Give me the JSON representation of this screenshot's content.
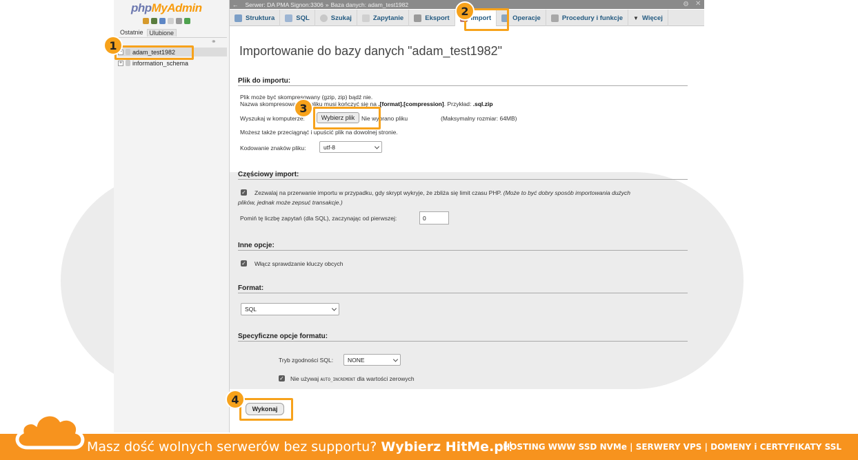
{
  "app": {
    "logo_php": "php",
    "logo_myadmin": "MyAdmin"
  },
  "nav": {
    "tabs": [
      "Ostatnie",
      "Ulubione"
    ],
    "databases": [
      "adam_test1982",
      "information_schema"
    ]
  },
  "breadcrumb": {
    "server": "Serwer: DA PMA Signon:3306",
    "separator": "»",
    "database": "Baza danych: adam_test1982"
  },
  "tabs": [
    {
      "label": "Struktura",
      "icon": "structure-icon"
    },
    {
      "label": "SQL",
      "icon": "sql-icon"
    },
    {
      "label": "Szukaj",
      "icon": "search-icon"
    },
    {
      "label": "Zapytanie",
      "icon": "query-icon"
    },
    {
      "label": "Eksport",
      "icon": "export-icon"
    },
    {
      "label": "Import",
      "icon": "import-icon",
      "active": true
    },
    {
      "label": "Operacje",
      "icon": "wrench-icon"
    },
    {
      "label": "Procedury i funkcje",
      "icon": "routines-icon"
    },
    {
      "label": "Więcej",
      "icon": "chevron-down-icon"
    }
  ],
  "page": {
    "title": "Importowanie do bazy danych \"adam_test1982\""
  },
  "file_section": {
    "legend": "Plik do importu:",
    "line1": "Plik może być skompresowany (gzip, zip) bądź nie.",
    "line2_prefix": "Nazwa skompresowanego pliku musi kończyć się na ",
    "line2_format": ".[format].[compression]",
    "line2_mid": ". Przykład: ",
    "line2_example": ".sql.zip",
    "browse_label": "Wyszukaj w komputerze:",
    "choose_button": "Wybierz plik",
    "no_file": "Nie wybrano pliku",
    "max_size": "(Maksymalny rozmiar: 64MB)",
    "drag_hint": "Możesz także przeciągnąć i upuścić plik na dowolnej stronie.",
    "charset_label": "Kodowanie znaków pliku:",
    "charset_value": "utf-8"
  },
  "partial_section": {
    "legend": "Częściowy import:",
    "allow_interrupt": "Zezwalaj na przerwanie importu w przypadku, gdy skrypt wykryje, że zbliża się limit czasu PHP.",
    "allow_interrupt_note1": "(Może to być dobry sposób importowania dużych",
    "allow_interrupt_note2": "plików, jednak może zepsuć transakcje.)",
    "skip_label": "Pomiń tę liczbę zapytań (dla SQL), zaczynając od pierwszej:",
    "skip_value": "0"
  },
  "other_section": {
    "legend": "Inne opcje:",
    "fk_checks": "Włącz sprawdzanie kluczy obcych"
  },
  "format_section": {
    "legend": "Format:",
    "value": "SQL"
  },
  "format_specific": {
    "legend": "Specyficzne opcje formatu:",
    "compat_label": "Tryb zgodności SQL:",
    "compat_value": "NONE",
    "no_auto_prefix": "Nie używaj",
    "no_auto_code": "AUTO_INCREMENT",
    "no_auto_suffix": "dla wartości zerowych"
  },
  "submit": {
    "label": "Wykonaj"
  },
  "callouts": [
    "1",
    "2",
    "3",
    "4"
  ],
  "footer": {
    "msg": "Masz dość wolnych serwerów bez supportu? ",
    "msg_bold": "Wybierz HitMe.pl",
    "msg_end": "!",
    "right": "HOSTING WWW SSD NVMe | SERWERY VPS | DOMENY i CERTYFIKATY SSL"
  },
  "colors": {
    "accent_orange": "#f7a21b",
    "footer_orange": "#f7931e",
    "tab_link": "#235a81"
  }
}
